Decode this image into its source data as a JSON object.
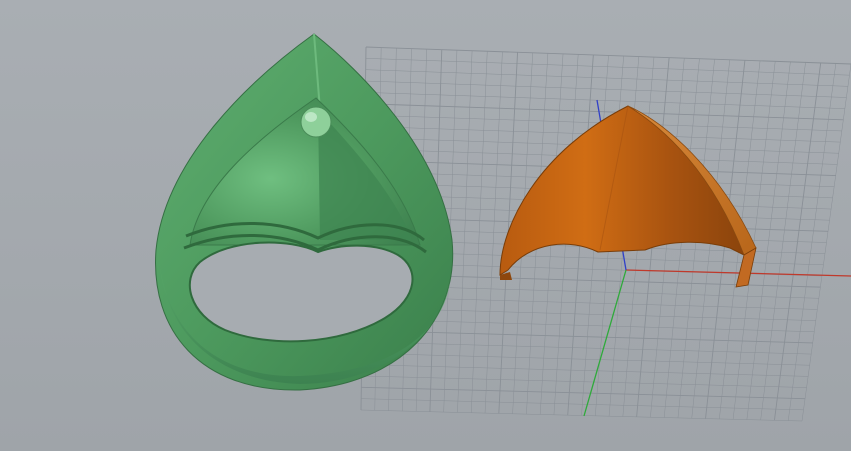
{
  "viewport": {
    "view": "perspective",
    "background_color": "#a6abb0",
    "grid_color": "#8a9097",
    "axis_colors": {
      "x": "#c0392b",
      "y": "#2eaa3a",
      "z": "#3040c8"
    }
  },
  "objects": [
    {
      "name": "ring",
      "kind": "solid",
      "color": "#4f9a5f",
      "selected": false
    },
    {
      "name": "crown-shell",
      "kind": "surface",
      "color": "#c9650e",
      "selected": false
    }
  ]
}
